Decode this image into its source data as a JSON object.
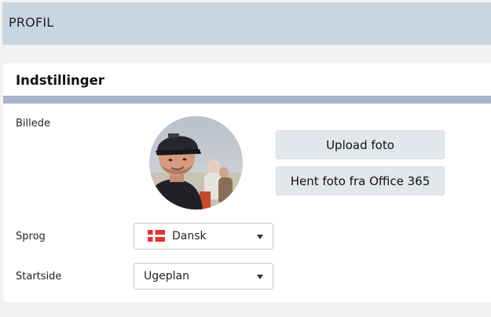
{
  "header": {
    "title": "PROFIL"
  },
  "settings": {
    "title": "Indstillinger",
    "picture_label": "Billede",
    "upload_button": "Upload foto",
    "office_button": "Hent foto fra Office 365",
    "language": {
      "label": "Sprog",
      "value": "Dansk",
      "flag_icon": "denmark-flag-icon"
    },
    "startpage": {
      "label": "Startside",
      "value": "Ugeplan"
    }
  },
  "colors": {
    "header_bg": "#c8d6e4",
    "section_bar": "#a7b4ca",
    "button_bg": "#e4e6ed",
    "flag_red": "#e3342f"
  }
}
